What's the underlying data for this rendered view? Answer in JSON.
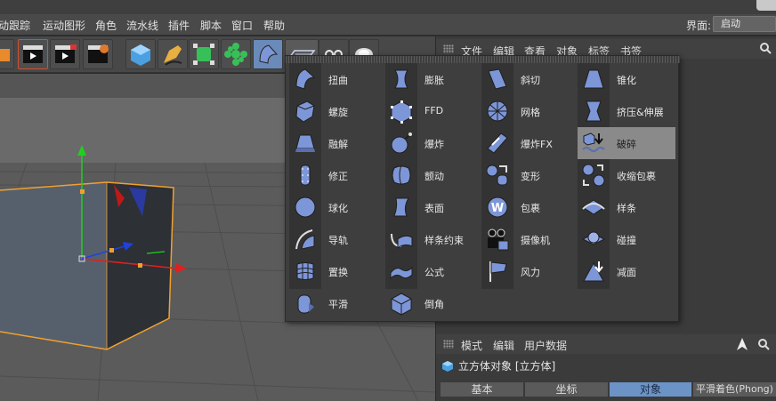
{
  "menubar": {
    "items": [
      "动跟踪",
      "运动图形",
      "角色",
      "流水线",
      "插件",
      "脚本",
      "窗口",
      "帮助"
    ],
    "layout_label": "界面:",
    "layout_value": "启动"
  },
  "object_manager": {
    "menu": [
      "文件",
      "编辑",
      "查看",
      "对象",
      "标签",
      "书签"
    ]
  },
  "deformer_menu": {
    "columns": [
      [
        {
          "label": "扭曲",
          "icon": "bend-icon"
        },
        {
          "label": "螺旋",
          "icon": "twist-icon"
        },
        {
          "label": "融解",
          "icon": "melt-icon"
        },
        {
          "label": "修正",
          "icon": "correction-icon"
        },
        {
          "label": "球化",
          "icon": "spherify-icon"
        },
        {
          "label": "导轨",
          "icon": "rail-icon"
        },
        {
          "label": "置换",
          "icon": "displacer-icon"
        },
        {
          "label": "平滑",
          "icon": "smoothing-icon"
        }
      ],
      [
        {
          "label": "膨胀",
          "icon": "bulge-icon"
        },
        {
          "label": "FFD",
          "icon": "ffd-icon"
        },
        {
          "label": "爆炸",
          "icon": "explosion-icon"
        },
        {
          "label": "颤动",
          "icon": "jiggle-icon"
        },
        {
          "label": "表面",
          "icon": "surface-icon"
        },
        {
          "label": "样条约束",
          "icon": "spline-wrap-icon"
        },
        {
          "label": "公式",
          "icon": "formula-icon"
        },
        {
          "label": "倒角",
          "icon": "bevel-icon"
        }
      ],
      [
        {
          "label": "斜切",
          "icon": "shear-icon"
        },
        {
          "label": "网格",
          "icon": "mesh-icon"
        },
        {
          "label": "爆炸FX",
          "icon": "explosion-fx-icon"
        },
        {
          "label": "变形",
          "icon": "morph-icon"
        },
        {
          "label": "包裹",
          "icon": "wrap-icon"
        },
        {
          "label": "摄像机",
          "icon": "camera-icon"
        },
        {
          "label": "风力",
          "icon": "wind-icon"
        }
      ],
      [
        {
          "label": "锥化",
          "icon": "taper-icon"
        },
        {
          "label": "挤压&伸展",
          "icon": "squash-stretch-icon"
        },
        {
          "label": "破碎",
          "icon": "shatter-icon"
        },
        {
          "label": "收缩包裹",
          "icon": "shrink-wrap-icon"
        },
        {
          "label": "样条",
          "icon": "spline-icon"
        },
        {
          "label": "碰撞",
          "icon": "collision-icon"
        },
        {
          "label": "减面",
          "icon": "polygon-reduction-icon"
        }
      ]
    ],
    "highlighted": "破碎"
  },
  "attribute_manager": {
    "menu": [
      "模式",
      "编辑",
      "用户数据"
    ],
    "object_title": "立方体对象 [立方体]",
    "tabs": [
      "基本",
      "坐标",
      "对象",
      "平滑着色(Phong)"
    ],
    "selected_tab": "对象"
  },
  "colors": {
    "accent": "#6c93c6",
    "icon_blue": "#7d96d8",
    "highlight": "#8a8a8a",
    "axis_x": "#e02020",
    "axis_y": "#20d020",
    "axis_z": "#2040e0",
    "selection_outline": "#f0a030"
  }
}
